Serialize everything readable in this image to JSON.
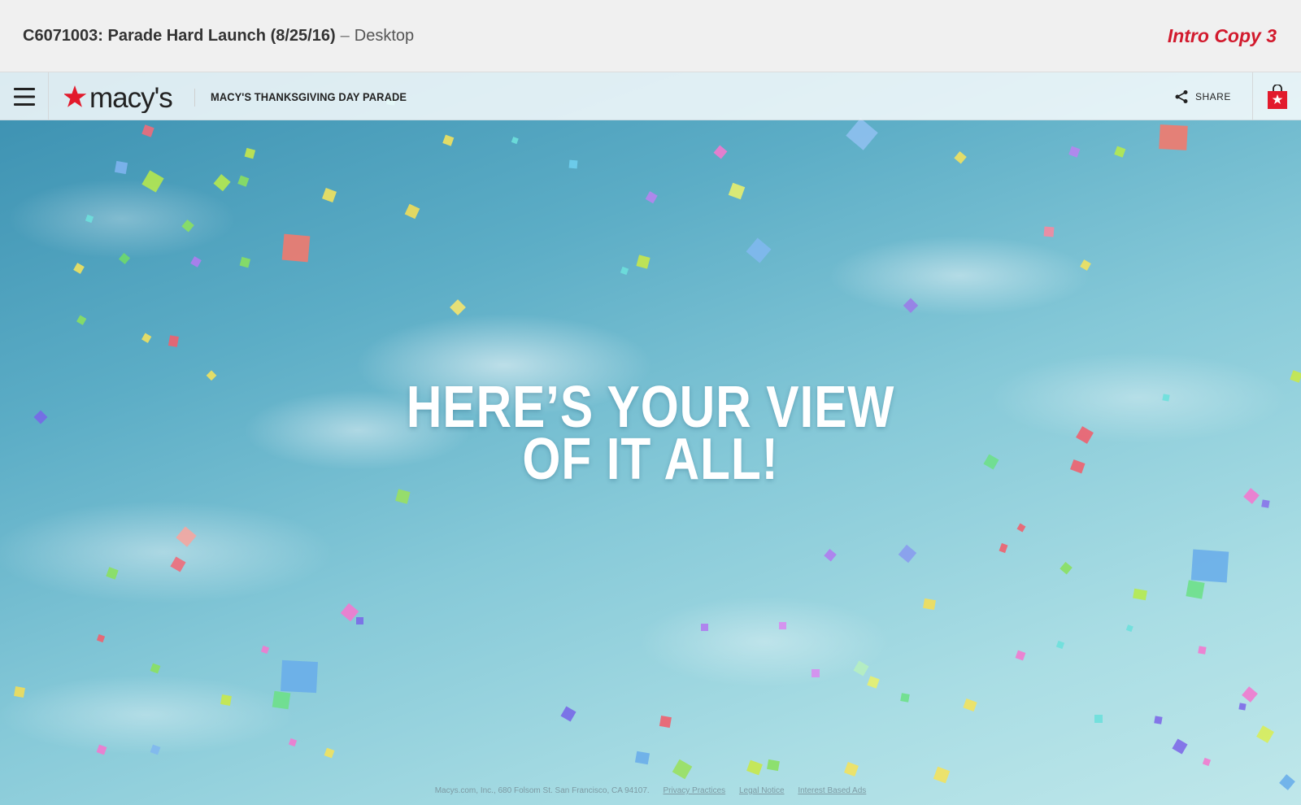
{
  "header": {
    "project_title": "C6071003: Parade Hard Launch (8/25/16)",
    "separator": "–",
    "view_name": "Desktop",
    "screen_label": "Intro Copy 3"
  },
  "nav": {
    "logo_text": "macy's",
    "title": "MACY'S THANKSGIVING DAY PARADE",
    "share_label": "SHARE"
  },
  "hero": {
    "headline_line1": "HERE’S YOUR VIEW",
    "headline_line2": "OF IT ALL!"
  },
  "footer": {
    "address": "Macys.com, Inc., 680 Folsom St. San Francisco, CA 94107.",
    "links": [
      "Privacy Practices",
      "Legal Notice",
      "Interest Based Ads"
    ]
  },
  "colors": {
    "brand_red": "#e21a2c",
    "label_red": "#d21a2d",
    "sky_top": "#3a8fb0",
    "sky_bottom": "#bfe7ea"
  },
  "icons": [
    "menu-icon",
    "star-icon",
    "share-icon",
    "shopping-bag-icon"
  ]
}
